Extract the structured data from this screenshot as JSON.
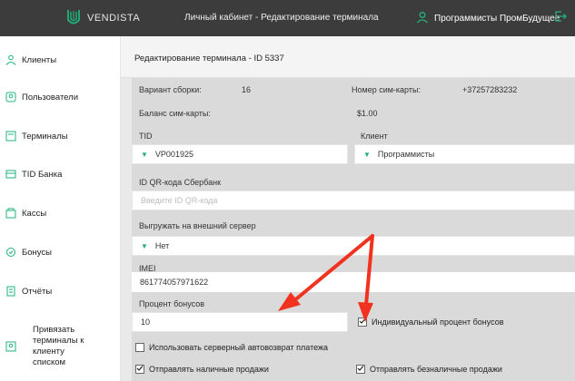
{
  "header": {
    "logo_text": "VENDISTA",
    "title": "Личный кабинет - Редактирование терминала",
    "user_name": "Программисты ПромБудущее"
  },
  "sidebar": {
    "items": [
      {
        "label": "Клиенты",
        "icon": "users-icon"
      },
      {
        "label": "Пользователи",
        "icon": "user-icon"
      },
      {
        "label": "Терминалы",
        "icon": "terminal-icon"
      },
      {
        "label": "TID Банка",
        "icon": "bank-icon"
      },
      {
        "label": "Кассы",
        "icon": "cash-register-icon"
      },
      {
        "label": "Бонусы",
        "icon": "bonus-icon"
      },
      {
        "label": "Отчёты",
        "icon": "report-icon"
      },
      {
        "label": "Привязать терминалы к клиенту списком",
        "icon": "link-users-icon"
      }
    ]
  },
  "form": {
    "title": "Редактирование терминала - ID 5337",
    "build_label": "Вариант сборки:",
    "build_value": "16",
    "sim_number_label": "Номер сим-карты:",
    "sim_number_value": "+37257283232",
    "sim_balance_label": "Баланс сим-карты:",
    "sim_balance_value": "$1.00",
    "tid_label": "TID",
    "tid_value": "VP001925",
    "client_label": "Клиент",
    "client_value": "Программисты",
    "qr_label": "ID QR-кода Сбербанк",
    "qr_placeholder": "Введите ID QR-кода",
    "export_label": "Выгружать на внешний сервер",
    "export_value": "Нет",
    "imei_label": "IMEI",
    "imei_value": "861774057971622",
    "bonus_label": "Процент бонусов",
    "bonus_value": "10",
    "individual_bonus_label": "Индивидуальный процент бонусов",
    "individual_bonus_checked": true,
    "server_autoreturn_label": "Использовать серверный автовозврат платежа",
    "server_autoreturn_checked": false,
    "send_cash_label": "Отправлять наличные продажи",
    "send_cash_checked": true,
    "send_cashless_label": "Отправлять безналичные продажи",
    "send_cashless_checked": true
  },
  "colors": {
    "topbar": "#3c3c3c",
    "accent_green": "#1fb37a",
    "annotation_red": "#f0321e"
  }
}
